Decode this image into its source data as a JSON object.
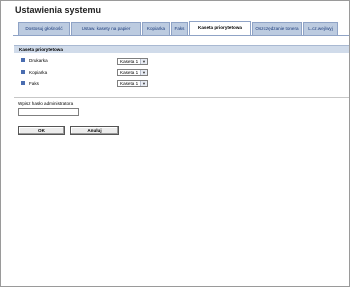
{
  "page": {
    "title": "Ustawienia systemu"
  },
  "tabs": [
    {
      "label": "Dostosuj głośność"
    },
    {
      "label": "Ustaw. kasety na papier"
    },
    {
      "label": "Kopiarka"
    },
    {
      "label": "Faks"
    },
    {
      "label": "Kaseta priorytetowa",
      "active": true
    },
    {
      "label": "Oszczędzanie tonera"
    },
    {
      "label": "L.cz.wej/wyj"
    }
  ],
  "section": {
    "title": "Kaseta priorytetowa"
  },
  "settings": [
    {
      "label": "Drukarka",
      "value": "Kaseta 1"
    },
    {
      "label": "Kopiarka",
      "value": "Kaseta 1"
    },
    {
      "label": "Faks",
      "value": "Kaseta 1"
    }
  ],
  "password": {
    "label": "Wpisz hasło administratora",
    "value": ""
  },
  "buttons": {
    "ok": "OK",
    "cancel": "Anuluj"
  },
  "colors": {
    "tab_bg": "#bccbe0",
    "section_bg": "#d0dbea",
    "bullet": "#4a6db0"
  }
}
